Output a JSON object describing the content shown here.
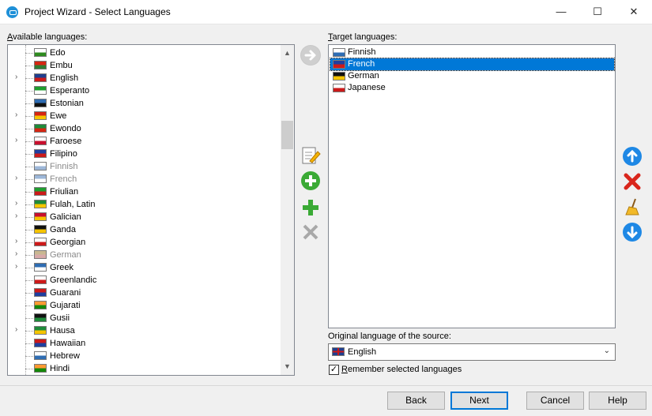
{
  "window": {
    "title": "Project Wizard - Select Languages",
    "minimize_glyph": "—",
    "maximize_glyph": "☐",
    "close_glyph": "✕"
  },
  "available": {
    "label_accel": "A",
    "label_rest": "vailable languages:",
    "items": [
      {
        "name": "Edo",
        "expandable": false,
        "disabled": false,
        "flag": [
          "#ffffff",
          "#2e8b1f"
        ]
      },
      {
        "name": "Embu",
        "expandable": false,
        "disabled": false,
        "flag": [
          "#d62612",
          "#2e7d32"
        ]
      },
      {
        "name": "English",
        "expandable": true,
        "disabled": false,
        "flag": [
          "#1f3f8f",
          "#cc1a1a"
        ]
      },
      {
        "name": "Esperanto",
        "expandable": false,
        "disabled": false,
        "flag": [
          "#1e9e2e",
          "#ffffff"
        ]
      },
      {
        "name": "Estonian",
        "expandable": false,
        "disabled": false,
        "flag": [
          "#2f6db3",
          "#111111"
        ]
      },
      {
        "name": "Ewe",
        "expandable": true,
        "disabled": false,
        "flag": [
          "#d62612",
          "#f5c400"
        ]
      },
      {
        "name": "Ewondo",
        "expandable": false,
        "disabled": false,
        "flag": [
          "#1e8b3a",
          "#d62612"
        ]
      },
      {
        "name": "Faroese",
        "expandable": true,
        "disabled": false,
        "flag": [
          "#ffffff",
          "#c8102e"
        ]
      },
      {
        "name": "Filipino",
        "expandable": false,
        "disabled": false,
        "flag": [
          "#1f3f9f",
          "#cc1a1a"
        ]
      },
      {
        "name": "Finnish",
        "expandable": false,
        "disabled": true,
        "flag": [
          "#ffffff",
          "#9db7d8"
        ]
      },
      {
        "name": "French",
        "expandable": true,
        "disabled": true,
        "flag": [
          "#9db7d8",
          "#ffffff"
        ]
      },
      {
        "name": "Friulian",
        "expandable": false,
        "disabled": false,
        "flag": [
          "#1e9e2e",
          "#cc1a1a"
        ]
      },
      {
        "name": "Fulah, Latin",
        "expandable": true,
        "disabled": false,
        "flag": [
          "#1e8b3a",
          "#f5c400"
        ]
      },
      {
        "name": "Galician",
        "expandable": true,
        "disabled": false,
        "flag": [
          "#c8102e",
          "#f5c400"
        ]
      },
      {
        "name": "Ganda",
        "expandable": false,
        "disabled": false,
        "flag": [
          "#111111",
          "#f5c400"
        ]
      },
      {
        "name": "Georgian",
        "expandable": true,
        "disabled": false,
        "flag": [
          "#ffffff",
          "#cc1a1a"
        ]
      },
      {
        "name": "German",
        "expandable": true,
        "disabled": true,
        "flag": [
          "#c9b891",
          "#d8a9a9"
        ]
      },
      {
        "name": "Greek",
        "expandable": true,
        "disabled": false,
        "flag": [
          "#2f6db3",
          "#ffffff"
        ]
      },
      {
        "name": "Greenlandic",
        "expandable": false,
        "disabled": false,
        "flag": [
          "#ffffff",
          "#cc1a1a"
        ]
      },
      {
        "name": "Guarani",
        "expandable": false,
        "disabled": false,
        "flag": [
          "#cc1a1a",
          "#1f3f9f"
        ]
      },
      {
        "name": "Gujarati",
        "expandable": false,
        "disabled": false,
        "flag": [
          "#ff9933",
          "#138808"
        ]
      },
      {
        "name": "Gusii",
        "expandable": false,
        "disabled": false,
        "flag": [
          "#111111",
          "#1e8b3a"
        ]
      },
      {
        "name": "Hausa",
        "expandable": true,
        "disabled": false,
        "flag": [
          "#1e8b3a",
          "#f5c400"
        ]
      },
      {
        "name": "Hawaiian",
        "expandable": false,
        "disabled": false,
        "flag": [
          "#cc1a1a",
          "#1f3f9f"
        ]
      },
      {
        "name": "Hebrew",
        "expandable": false,
        "disabled": false,
        "flag": [
          "#ffffff",
          "#2f6db3"
        ]
      },
      {
        "name": "Hindi",
        "expandable": false,
        "disabled": false,
        "flag": [
          "#ff9933",
          "#138808"
        ]
      }
    ],
    "scroll_up": "▲",
    "scroll_down": "▼"
  },
  "target": {
    "label_accel": "T",
    "label_rest": "arget languages:",
    "items": [
      {
        "name": "Finnish",
        "selected": false,
        "flag": [
          "#ffffff",
          "#2f6db3"
        ]
      },
      {
        "name": "French",
        "selected": true,
        "flag": [
          "#1f3f9f",
          "#cc1a1a"
        ]
      },
      {
        "name": "German",
        "selected": false,
        "flag": [
          "#111111",
          "#f5c400"
        ]
      },
      {
        "name": "Japanese",
        "selected": false,
        "flag": [
          "#ffffff",
          "#cc1a1a"
        ]
      }
    ]
  },
  "original": {
    "label": "Original language of the source:",
    "value": "English",
    "arrow": "⌄"
  },
  "remember": {
    "checked": true,
    "check_glyph": "✓",
    "label_accel": "R",
    "label_rest": "emember selected languages"
  },
  "buttons": {
    "back": "Back",
    "next": "Next",
    "cancel": "Cancel",
    "help": "Help"
  },
  "colors": {
    "accent": "#0078d7",
    "add_green": "#3aaa35",
    "delete_red": "#d9261c",
    "move_blue": "#1e88e5"
  }
}
